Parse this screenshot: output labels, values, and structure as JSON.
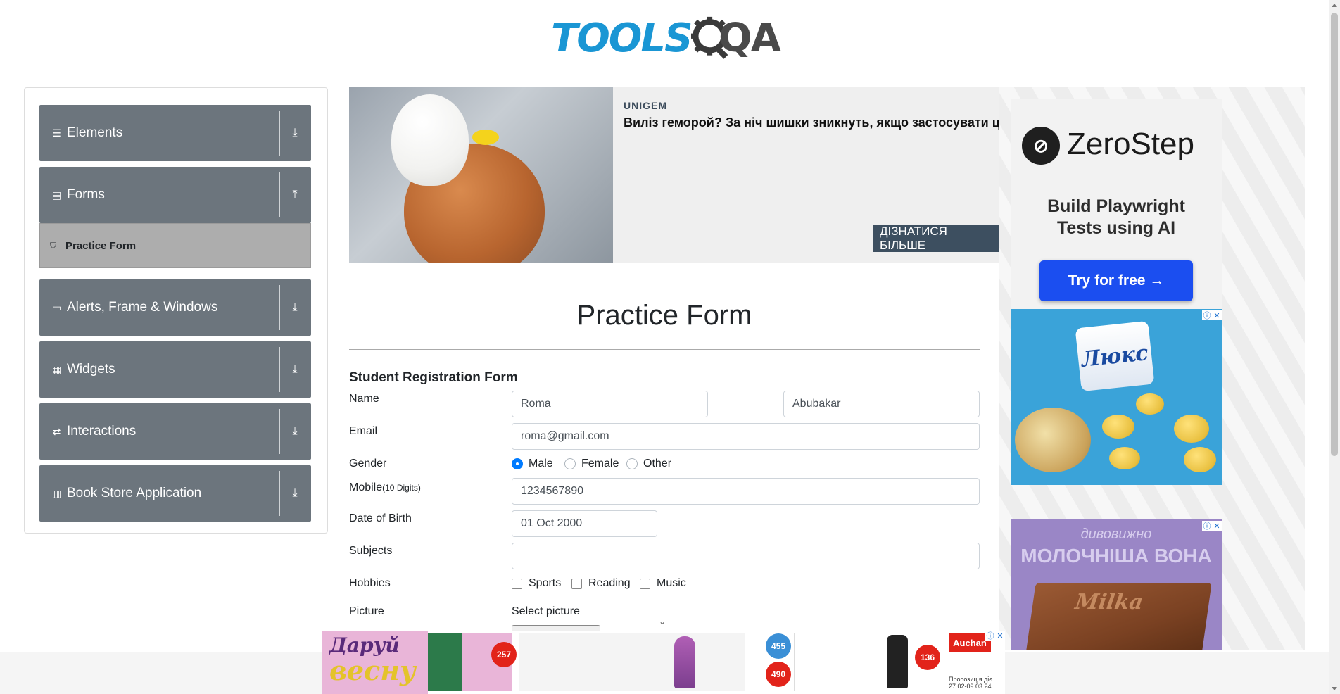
{
  "logo": {
    "part1": "TOOLS",
    "part2": "QA"
  },
  "nav": {
    "groups": [
      {
        "label": "Elements",
        "icon": "list-icon",
        "arrow": "download-arrow-icon"
      },
      {
        "label": "Forms",
        "icon": "document-icon",
        "arrow": "upload-arrow-icon"
      },
      {
        "label": "Alerts, Frame & Windows",
        "icon": "window-icon",
        "arrow": "download-arrow-icon"
      },
      {
        "label": "Widgets",
        "icon": "widgets-icon",
        "arrow": "download-arrow-icon"
      },
      {
        "label": "Interactions",
        "icon": "interactions-icon",
        "arrow": "download-arrow-icon"
      },
      {
        "label": "Book Store Application",
        "icon": "books-icon",
        "arrow": "download-arrow-icon"
      }
    ],
    "forms_sub": {
      "label": "Practice Form",
      "icon": "html5-icon"
    }
  },
  "top_ad": {
    "brand": "UNIGEM",
    "headline": "Виліз геморой? За ніч шишки зникнуть, якщо застосувати ц",
    "cta": "ДІЗНАТИСЯ БІЛЬШЕ"
  },
  "right_ads": {
    "zerostep": {
      "name": "ZeroStep",
      "tagline": "Build Playwright Tests using AI",
      "button": "Try for free →"
    },
    "chips": {
      "brand": "Люкс"
    },
    "milka": {
      "line1": "дивовижно",
      "line2": "МОЛОЧНІША ВОНА",
      "brand": "Milka"
    }
  },
  "form": {
    "page_title": "Practice Form",
    "subtitle": "Student Registration Form",
    "name_label": "Name",
    "first_name": "Roma",
    "last_name": "Abubakar",
    "email_label": "Email",
    "email": "roma@gmail.com",
    "gender_label": "Gender",
    "gender_options": [
      "Male",
      "Female",
      "Other"
    ],
    "gender_selected": "Male",
    "mobile_label": "Mobile",
    "mobile_hint": "(10 Digits)",
    "mobile": "1234567890",
    "dob_label": "Date of Birth",
    "dob": "01 Oct 2000",
    "subjects_label": "Subjects",
    "subjects": "",
    "hobbies_label": "Hobbies",
    "hobbies": [
      "Sports",
      "Reading",
      "Music"
    ],
    "picture_label": "Picture",
    "picture_hint": "Select picture"
  },
  "bottom_ad": {
    "headline_1": "Даруй",
    "headline_2": "весну",
    "prices": [
      "257",
      "455",
      "490",
      "136"
    ],
    "store": "Auchan",
    "dates": "Пропозиція діє 27.02-09.03.24"
  }
}
